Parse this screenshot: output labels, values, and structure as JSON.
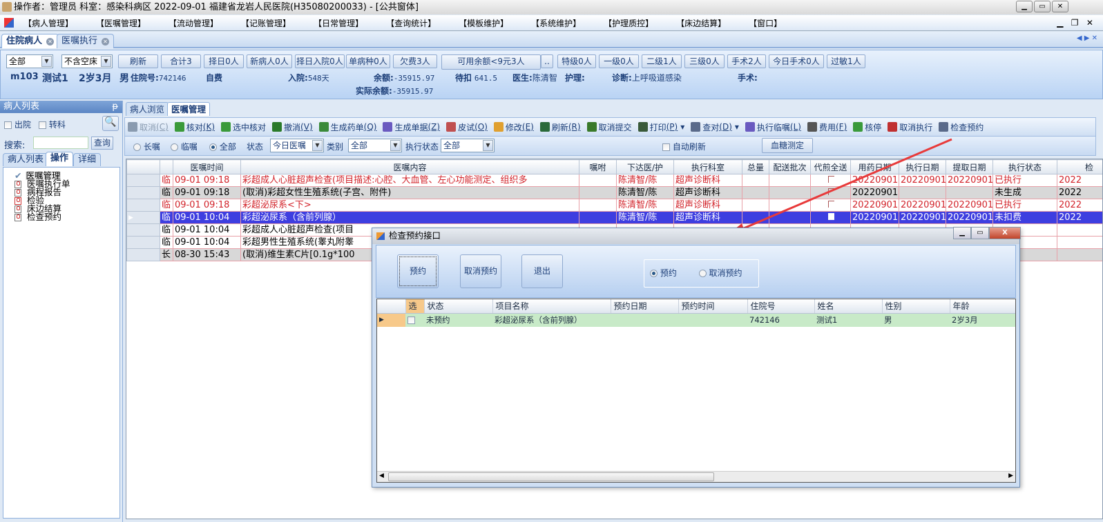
{
  "window": {
    "title": "操作者：管理员  科室：感染科病区  2022-09-01  福建省龙岩人民医院(H35080200033) - [公共窗体]"
  },
  "menu": [
    "【病人管理】",
    "【医嘱管理】",
    "【流动管理】",
    "【记账管理】",
    "【日常管理】",
    "【查询统计】",
    "【模板维护】",
    "【系统维护】",
    "【护理质控】",
    "【床边结算】",
    "【窗口】"
  ],
  "doc_tabs": [
    "住院病人",
    "医嘱执行"
  ],
  "filter": {
    "ward": "全部",
    "bed": "不含空床",
    "buttons": [
      "刷新",
      "合计3",
      "择日0人",
      "新病人0人",
      "择日入院0人",
      "单病种0人",
      "欠费3人",
      "可用余额<9元3人",
      "..",
      "特级0人",
      "一级0人",
      "二级1人",
      "三级0人",
      "手术2人",
      "今日手术0人",
      "过敏1人"
    ]
  },
  "patient": {
    "bed": "m103",
    "name": "测试1",
    "age": "2岁3月",
    "sex": "男",
    "inpatient_no_label": "住院号:",
    "inpatient_no": "742146",
    "pay_type": "自费",
    "admit_label": "入院:",
    "admit_days": "548天",
    "balance_label": "余额:",
    "balance": "-35915.97",
    "actual_balance_label": "实际余额:",
    "actual_balance": "-35915.97",
    "pending_label": "待扣",
    "pending": "641.5",
    "doctor_label": "医生:",
    "doctor": "陈清智",
    "nurse_label": "护理:",
    "diag_label": "诊断:",
    "diagnosis": "上呼吸道感染",
    "surgery_label": "手术:"
  },
  "left": {
    "title": "病人列表",
    "pin": "ᵽ",
    "discharged": "出院",
    "transfer": "转科",
    "search_label": "搜索:",
    "search_value": "",
    "query": "查询",
    "tabs": [
      "病人列表",
      "操作",
      "详细"
    ],
    "tree": [
      "医嘱管理",
      "医嘱执行单",
      "病程报告",
      "检验",
      "床边结算",
      "检查预约"
    ]
  },
  "main_tabs": [
    "病人浏览",
    "医嘱管理"
  ],
  "toolbar": [
    {
      "label": "取消",
      "key": "(C)",
      "color": "#8a9bb0",
      "disabled": true
    },
    {
      "label": "核对",
      "key": "(K)",
      "color": "#3a9a3a"
    },
    {
      "label": "选中核对",
      "key": "",
      "color": "#3a9a3a"
    },
    {
      "label": "撤消",
      "key": "(V)",
      "color": "#2a7a2a"
    },
    {
      "label": "生成药单",
      "key": "(Q)",
      "color": "#3a8a3a"
    },
    {
      "label": "生成单据",
      "key": "(Z)",
      "color": "#6a5ac0"
    },
    {
      "label": "皮试",
      "key": "(O)",
      "color": "#c05050"
    },
    {
      "label": "修改",
      "key": "(E)",
      "color": "#e0a030"
    },
    {
      "label": "刷新",
      "key": "(R)",
      "color": "#2a6a3a"
    },
    {
      "label": "取消提交",
      "key": "",
      "color": "#3a7a2a"
    },
    {
      "label": "打印",
      "key": "(P)",
      "color": "#3a5a3a",
      "dropdown": true
    },
    {
      "label": "查对",
      "key": "(D)",
      "color": "#5a6a8a",
      "dropdown": true
    },
    {
      "label": "执行临嘱",
      "key": "(L)",
      "color": "#6a5ac0"
    },
    {
      "label": "费用",
      "key": "(F)",
      "color": "#555"
    },
    {
      "label": "核停",
      "key": "",
      "color": "#3a9a3a"
    },
    {
      "label": "取消执行",
      "key": "",
      "color": "#c03030"
    },
    {
      "label": "检查预约",
      "key": "",
      "color": "#5a6a8a"
    }
  ],
  "order_filter": {
    "long": "长嘱",
    "temp": "临嘱",
    "all": "全部",
    "status_label": "状态",
    "status": "今日医嘱",
    "category_label": "类别",
    "category": "全部",
    "exec_label": "执行状态",
    "exec": "全部",
    "auto_refresh": "自动刷新",
    "glucose": "血糖测定"
  },
  "grid": {
    "columns": [
      "",
      "",
      "医嘱时间",
      "医嘱内容",
      "嘱咐",
      "下达医/护",
      "执行科室",
      "总量",
      "配送批次",
      "代煎全送",
      "用药日期",
      "执行日期",
      "提取日期",
      "执行状态",
      "检"
    ],
    "rows": [
      {
        "style": "red",
        "type": "临",
        "time": "09-01  09:18",
        "content": "彩超成人心脏超声检查(项目描述:心腔、大血管、左心功能测定、组织多",
        "doctor": "陈清智/陈",
        "dept": "超声诊断科",
        "use_date": "20220901",
        "exec_date": "20220901",
        "fetch_date": "20220901",
        "status": "已执行",
        "extra": "2022"
      },
      {
        "style": "gray",
        "type": "临",
        "time": "09-01  09:18",
        "content": "(取消)彩超女性生殖系统(子宫、附件)",
        "doctor": "陈清智/陈",
        "dept": "超声诊断科",
        "use_date": "20220901",
        "exec_date": "",
        "fetch_date": "",
        "status": "未生成",
        "extra": "2022"
      },
      {
        "style": "red",
        "type": "临",
        "time": "09-01  09:18",
        "content": "彩超泌尿系<下>",
        "doctor": "陈清智/陈",
        "dept": "超声诊断科",
        "use_date": "20220901",
        "exec_date": "20220901",
        "fetch_date": "20220901",
        "status": "已执行",
        "extra": "2022"
      },
      {
        "style": "sel",
        "type": "临",
        "time": "09-01  10:04",
        "content": "彩超泌尿系（含前列腺）",
        "doctor": "陈清智/陈",
        "dept": "超声诊断科",
        "use_date": "20220901",
        "exec_date": "20220901",
        "fetch_date": "20220901",
        "status": "未扣费",
        "extra": "2022"
      },
      {
        "style": "blk",
        "type": "临",
        "time": "09-01  10:04",
        "content": "彩超成人心脏超声检查(项目",
        "doctor": "",
        "dept": "",
        "use_date": "",
        "exec_date": "",
        "fetch_date": "",
        "status": "",
        "extra": ""
      },
      {
        "style": "blk",
        "type": "临",
        "time": "09-01  10:04",
        "content": "彩超男性生殖系统(睾丸附睾",
        "doctor": "",
        "dept": "",
        "use_date": "",
        "exec_date": "",
        "fetch_date": "",
        "status": "",
        "extra": ""
      },
      {
        "style": "gray",
        "type": "长",
        "time": "08-30  15:43",
        "content": "(取消)维生素C片[0.1g*100",
        "doctor": "",
        "dept": "",
        "use_date": "",
        "exec_date": "",
        "fetch_date": "",
        "status": "",
        "extra": ""
      }
    ]
  },
  "dialog": {
    "title": "检查预约接口",
    "buttons": [
      "预约",
      "取消预约",
      "退出"
    ],
    "radio_book": "预约",
    "radio_cancel": "取消预约",
    "columns": [
      "",
      "选",
      "状态",
      "项目名称",
      "预约日期",
      "预约时间",
      "住院号",
      "姓名",
      "性别",
      "年龄"
    ],
    "rows": [
      {
        "status": "未预约",
        "item": "彩超泌尿系（含前列腺）",
        "date": "",
        "time": "",
        "inpatient_no": "742146",
        "name": "测试1",
        "sex": "男",
        "age": "2岁3月"
      }
    ]
  },
  "colors": {
    "accent": "#3e3ee0",
    "red_text": "#d2232a",
    "arrow": "#e83a3a"
  }
}
